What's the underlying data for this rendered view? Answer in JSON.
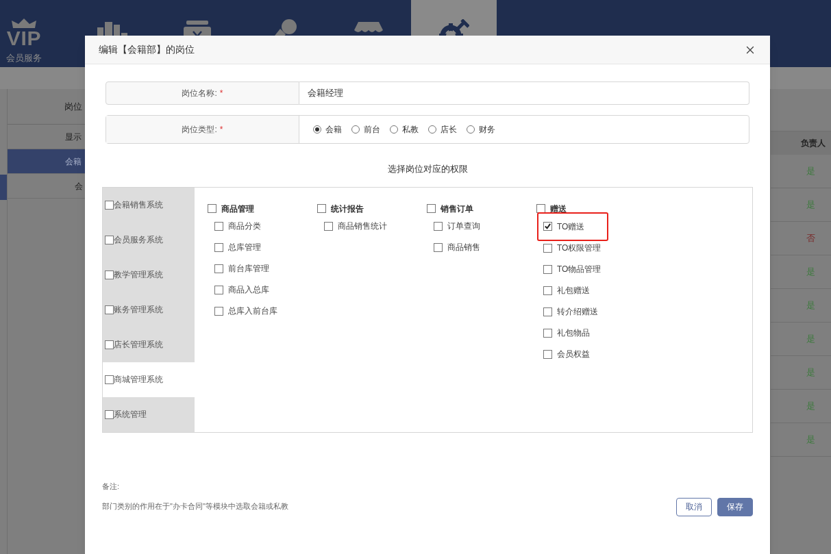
{
  "nav": {
    "logo": "VIP",
    "label": "会员服务",
    "items": [
      {
        "kind": "books",
        "selected": false
      },
      {
        "kind": "box",
        "selected": false
      },
      {
        "kind": "hand",
        "selected": false
      },
      {
        "kind": "shop",
        "selected": false
      },
      {
        "kind": "gear",
        "selected": true
      }
    ]
  },
  "background_table": {
    "header": "岗位",
    "rows": [
      {
        "text": "显示",
        "selected": false
      },
      {
        "text": "会籍",
        "selected": true
      },
      {
        "text": "会",
        "selected": false
      }
    ]
  },
  "background_right_table": {
    "header": "负责人",
    "rows": [
      {
        "text": "是",
        "color": "#3d7a3d"
      },
      {
        "text": "是",
        "color": "#3d7a3d"
      },
      {
        "text": "否",
        "color": "#7a2a2a"
      },
      {
        "text": "是",
        "color": "#3d7a3d"
      },
      {
        "text": "是",
        "color": "#3d7a3d"
      },
      {
        "text": "是",
        "color": "#3d7a3d"
      },
      {
        "text": "是",
        "color": "#3d7a3d"
      },
      {
        "text": "是",
        "color": "#3d7a3d"
      },
      {
        "text": "是",
        "color": "#3d7a3d"
      }
    ]
  },
  "dialog": {
    "title": "编辑【会籍部】的岗位",
    "name_field": {
      "label": "岗位名称:",
      "required": "*",
      "value": "会籍经理"
    },
    "type_field": {
      "label": "岗位类型:",
      "required": "*",
      "options": [
        {
          "label": "会籍",
          "selected": true
        },
        {
          "label": "前台",
          "selected": false
        },
        {
          "label": "私教",
          "selected": false
        },
        {
          "label": "店长",
          "selected": false
        },
        {
          "label": "财务",
          "selected": false
        }
      ]
    },
    "permissions_title": "选择岗位对应的权限",
    "systems": [
      {
        "label": "会籍销售系统",
        "checked": false,
        "selected": false
      },
      {
        "label": "会员服务系统",
        "checked": false,
        "selected": false
      },
      {
        "label": "教学管理系统",
        "checked": false,
        "selected": false
      },
      {
        "label": "账务管理系统",
        "checked": false,
        "selected": false
      },
      {
        "label": "店长管理系统",
        "checked": false,
        "selected": false
      },
      {
        "label": "商城管理系统",
        "checked": false,
        "selected": true
      },
      {
        "label": "系统管理",
        "checked": false,
        "selected": false
      }
    ],
    "groups": [
      {
        "label": "商品管理",
        "checked": false,
        "children": [
          {
            "label": "商品分类",
            "checked": false,
            "highlighted": false
          },
          {
            "label": "总库管理",
            "checked": false,
            "highlighted": false
          },
          {
            "label": "前台库管理",
            "checked": false,
            "highlighted": false
          },
          {
            "label": "商品入总库",
            "checked": false,
            "highlighted": false
          },
          {
            "label": "总库入前台库",
            "checked": false,
            "highlighted": false
          }
        ]
      },
      {
        "label": "统计报告",
        "checked": false,
        "children": [
          {
            "label": "商品销售统计",
            "checked": false,
            "highlighted": false
          }
        ]
      },
      {
        "label": "销售订单",
        "checked": false,
        "children": [
          {
            "label": "订单查询",
            "checked": false,
            "highlighted": false
          },
          {
            "label": "商品销售",
            "checked": false,
            "highlighted": false
          }
        ]
      },
      {
        "label": "赠送",
        "checked": false,
        "children": [
          {
            "label": "TO赠送",
            "checked": true,
            "highlighted": true
          },
          {
            "label": "TO权限管理",
            "checked": false,
            "highlighted": false
          },
          {
            "label": "TO物品管理",
            "checked": false,
            "highlighted": false
          },
          {
            "label": "礼包赠送",
            "checked": false,
            "highlighted": false
          },
          {
            "label": "转介绍赠送",
            "checked": false,
            "highlighted": false
          },
          {
            "label": "礼包物品",
            "checked": false,
            "highlighted": false
          },
          {
            "label": "会员权益",
            "checked": false,
            "highlighted": false
          }
        ]
      }
    ],
    "note_label": "备注:",
    "note_text": "部门类别的作用在于\"办卡合同\"等模块中选取会籍或私教",
    "buttons": [
      {
        "label": "取消",
        "kind": "secondary"
      },
      {
        "label": "保存",
        "kind": "primary"
      }
    ]
  }
}
